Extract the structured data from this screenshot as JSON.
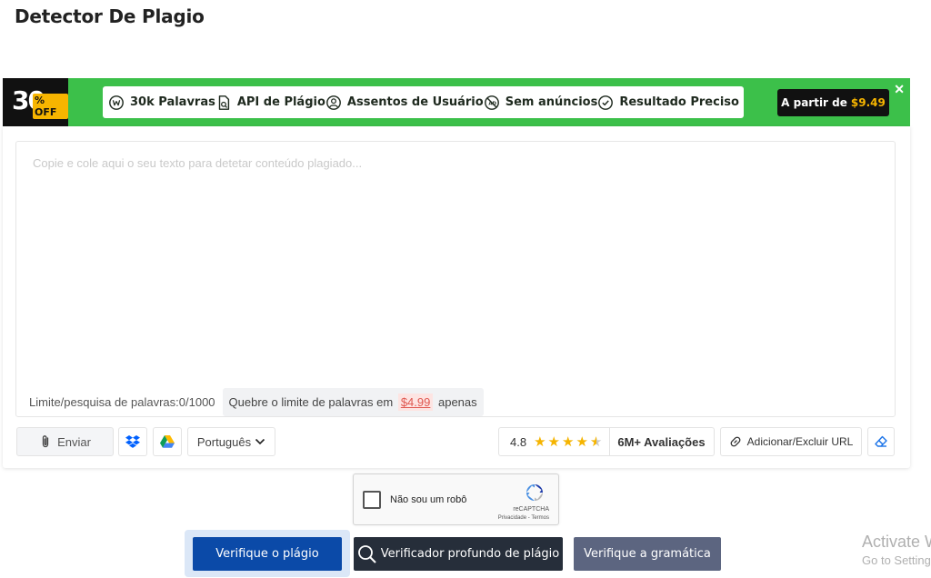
{
  "page": {
    "title": "Detector De Plagio"
  },
  "promo": {
    "badge_number": "30",
    "badge_off": "% OFF",
    "features": [
      {
        "icon": "w-circle-icon",
        "label": "30k Palavras"
      },
      {
        "icon": "document-search-icon",
        "label": "API de Plágio"
      },
      {
        "icon": "user-circle-icon",
        "label": "Assentos de Usuário"
      },
      {
        "icon": "no-ads-icon",
        "label": "Sem anúncios"
      },
      {
        "icon": "check-circle-icon",
        "label": "Resultado Preciso"
      }
    ],
    "cta_prefix": "A partir de",
    "cta_price": "$9.49",
    "close_label": "✕",
    "colors": {
      "background": "#3cc04a",
      "accent": "#f7b500"
    }
  },
  "editor": {
    "placeholder": "Copie e cole aqui o seu texto para detetar conteúdo plagiado...",
    "value": "",
    "limit_label": "Limite/pesquisa de palavras:",
    "limit_value": "0/1000",
    "upsell_prefix": "Quebre o limite de palavras em",
    "upsell_price": "$4.99",
    "upsell_suffix": "apenas"
  },
  "toolbar": {
    "upload_label": "Enviar",
    "language": "Português",
    "rating_score": "4.8",
    "rating_stars": 4.5,
    "reviews_label": "6M+ Avaliações",
    "url_label": "Adicionar/Excluir URL"
  },
  "captcha": {
    "label": "Não sou um robô",
    "brand": "reCAPTCHA",
    "terms": "Privacidade - Termos"
  },
  "actions": {
    "check_label": "Verifique o plágio",
    "deep_label": "Verificador profundo de plágio",
    "grammar_label": "Verifique a gramática"
  },
  "watermark": {
    "line1": "Activate W",
    "line2": "Go to Setting"
  }
}
